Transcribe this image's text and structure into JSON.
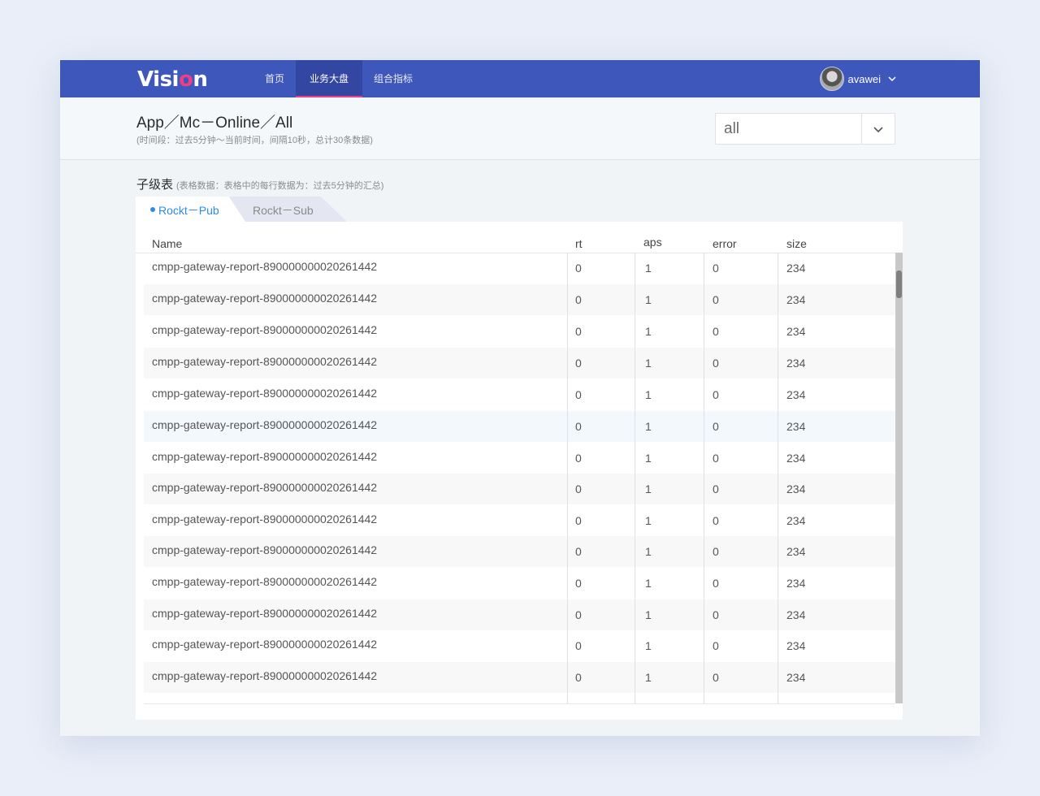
{
  "app": {
    "logo_main": "Visi",
    "logo_accent": "o",
    "logo_end": "n",
    "brand_colors": {
      "nav_bg": "#3e57ba",
      "accent": "#ee3f86",
      "link": "#2d8ceb"
    }
  },
  "nav": {
    "items": [
      {
        "label": "首页",
        "active": false
      },
      {
        "label": "业务大盘",
        "active": true
      },
      {
        "label": "组合指标",
        "active": false
      }
    ]
  },
  "user": {
    "name": "avawei",
    "avatar_icon": "cat-avatar",
    "menu_icon": "chevron-down-icon"
  },
  "header": {
    "breadcrumb": "App／Mc－Online／All",
    "subinfo": "(时间段：过去5分钟～当前时间，间隔10秒，总计30条数据)",
    "select_value": "all"
  },
  "section": {
    "title": "子级表",
    "note": "(表格数据：表格中的每行数据为：过去5分钟的汇总)"
  },
  "tabs": [
    {
      "label": "Rockt－Pub",
      "active": true
    },
    {
      "label": "Rockt－Sub",
      "active": false
    }
  ],
  "table": {
    "columns": [
      "Name",
      "rt",
      "aps",
      "error",
      "size"
    ],
    "rows": [
      [
        "cmpp-gateway-report-890000000020261442",
        "0",
        "1",
        "0",
        "234"
      ],
      [
        "cmpp-gateway-report-890000000020261442",
        "0",
        "1",
        "0",
        "234"
      ],
      [
        "cmpp-gateway-report-890000000020261442",
        "0",
        "1",
        "0",
        "234"
      ],
      [
        "cmpp-gateway-report-890000000020261442",
        "0",
        "1",
        "0",
        "234"
      ],
      [
        "cmpp-gateway-report-890000000020261442",
        "0",
        "1",
        "0",
        "234"
      ],
      [
        "cmpp-gateway-report-890000000020261442",
        "0",
        "1",
        "0",
        "234"
      ],
      [
        "cmpp-gateway-report-890000000020261442",
        "0",
        "1",
        "0",
        "234"
      ],
      [
        "cmpp-gateway-report-890000000020261442",
        "0",
        "1",
        "0",
        "234"
      ],
      [
        "cmpp-gateway-report-890000000020261442",
        "0",
        "1",
        "0",
        "234"
      ],
      [
        "cmpp-gateway-report-890000000020261442",
        "0",
        "1",
        "0",
        "234"
      ],
      [
        "cmpp-gateway-report-890000000020261442",
        "0",
        "1",
        "0",
        "234"
      ],
      [
        "cmpp-gateway-report-890000000020261442",
        "0",
        "1",
        "0",
        "234"
      ],
      [
        "cmpp-gateway-report-890000000020261442",
        "0",
        "1",
        "0",
        "234"
      ],
      [
        "cmpp-gateway-report-890000000020261442",
        "0",
        "1",
        "0",
        "234"
      ]
    ]
  }
}
